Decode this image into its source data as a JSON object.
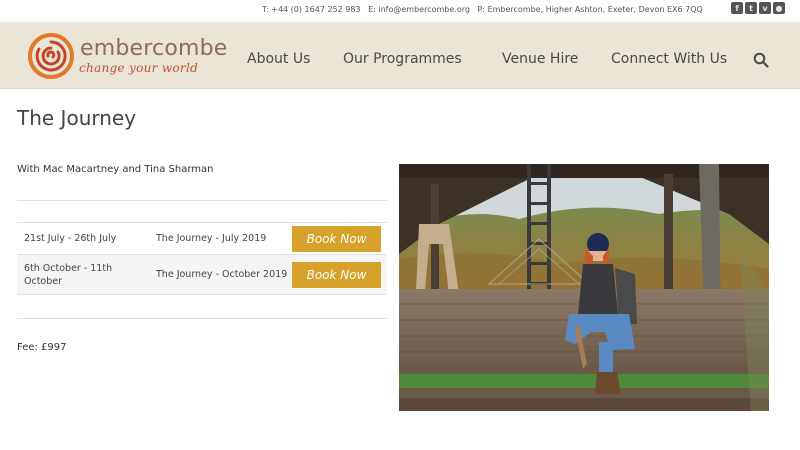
{
  "header": {
    "logo": {
      "name": "embercombe",
      "tagline": "change your world"
    },
    "contact": {
      "phone": "T: +44 (0) 1647 252 983",
      "email": "E: info@embercombe.org",
      "address": "P: Embercombe, Higher Ashton, Exeter, Devon EX6 7QQ"
    },
    "social": [
      {
        "icon": "facebook-icon",
        "glyph": "f"
      },
      {
        "icon": "twitter-icon",
        "glyph": "t"
      },
      {
        "icon": "vimeo-icon",
        "glyph": "v"
      },
      {
        "icon": "flickr-icon",
        "glyph": "●"
      }
    ],
    "nav": [
      {
        "label": "About Us"
      },
      {
        "label": "Our Programmes"
      },
      {
        "label": "Venue Hire"
      },
      {
        "label": "Connect With Us"
      }
    ],
    "search_icon": "search-icon"
  },
  "main": {
    "title": "The Journey",
    "facilitators": "With Mac Macartney and Tina Sharman",
    "dates": [
      {
        "date": "21st July - 26th July",
        "name": "The Journey - July 2019",
        "button": "Book Now"
      },
      {
        "date": "6th October - 11th October",
        "name": "The Journey - October 2019",
        "button": "Book Now"
      }
    ],
    "fee": "Fee: £997"
  },
  "colors": {
    "header_bg": "#ebe5d8",
    "button_bg": "#d7a22b",
    "logo_text": "#8a6d5d",
    "tagline": "#c2542a"
  }
}
